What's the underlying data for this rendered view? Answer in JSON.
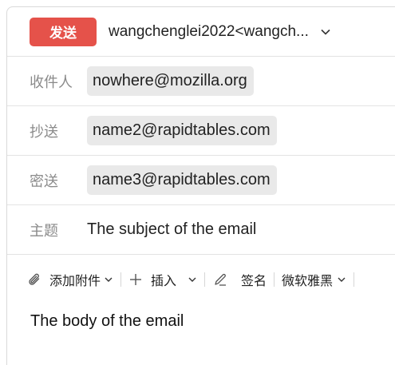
{
  "header": {
    "send_label": "发送",
    "from_account": "wangchenglei2022<wangch..."
  },
  "recipients": {
    "to_label": "收件人",
    "to_value": "nowhere@mozilla.org",
    "cc_label": "抄送",
    "cc_value": "name2@rapidtables.com",
    "bcc_label": "密送",
    "bcc_value": "name3@rapidtables.com"
  },
  "subject": {
    "label": "主题",
    "value": "The subject of the email"
  },
  "toolbar": {
    "attach_label": "添加附件",
    "insert_label": "插入",
    "signature_label": "签名",
    "font_label": "微软雅黑"
  },
  "body": {
    "text": "The body of the email"
  },
  "colors": {
    "send_button": "#e5524a",
    "chip_bg": "#e9e9e9",
    "label": "#8a8a8a"
  }
}
